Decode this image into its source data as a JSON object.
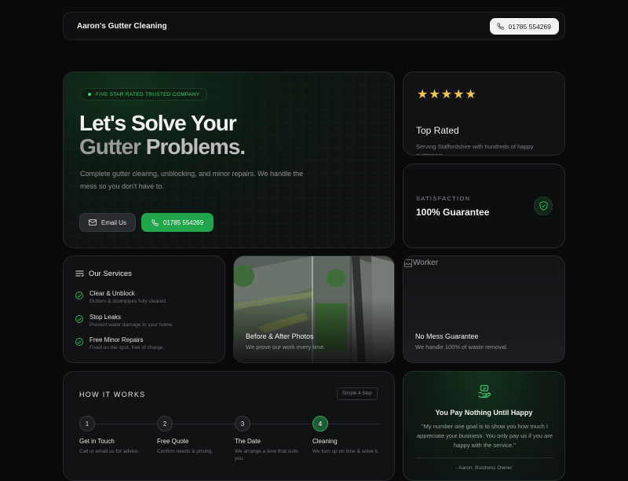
{
  "nav": {
    "brand": "Aaron's Gutter Cleaning",
    "phone": "01785 554269"
  },
  "hero": {
    "badge": "FIVE STAR RATED TRUSTED COMPANY",
    "title_line1": "Let's Solve Your",
    "title_line2_a": "Gutter",
    "title_line2_b": "Problems.",
    "subtitle": "Complete gutter clearing, unblocking, and minor repairs. We handle the mess so you don't have to.",
    "email_button": "Email Us",
    "call_button": "01785 554269"
  },
  "rated": {
    "stars": "★★★★★",
    "title": "Top Rated",
    "text": "Serving Staffordshire with hundreds of happy customers."
  },
  "guarantee": {
    "label": "SATISFACTION",
    "title": "100% Guarantee"
  },
  "services": {
    "title": "Our Services",
    "items": [
      {
        "title": "Clear & Unblock",
        "desc": "Gutters & downpipes fully cleared."
      },
      {
        "title": "Stop Leaks",
        "desc": "Prevent water damage to your home."
      },
      {
        "title": "Free Minor Repairs",
        "desc": "Fixed on the spot, free of charge."
      }
    ]
  },
  "photos": {
    "title": "Before & After Photos",
    "desc": "We prove our work every time."
  },
  "worker": {
    "alt": "Worker",
    "title": "No Mess Guarantee",
    "desc": "We handle 100% of waste removal."
  },
  "how": {
    "title": "HOW IT WORKS",
    "pill": "Simple 4-Step",
    "steps": [
      {
        "n": "1",
        "title": "Get in Touch",
        "desc": "Call or email us for advice."
      },
      {
        "n": "2",
        "title": "Free Quote",
        "desc": "Confirm needs & pricing."
      },
      {
        "n": "3",
        "title": "The Date",
        "desc": "We arrange a time that suits you."
      },
      {
        "n": "4",
        "title": "Cleaning",
        "desc": "We turn up on time & solve it."
      }
    ]
  },
  "happy": {
    "title": "You Pay Nothing Until Happy",
    "quote": "\"My number one goal is to show you how much I appreciate your business. You only pay us if you are happy with the service.\"",
    "author": "- Aaron, Business Owner"
  },
  "colors": {
    "accent": "#21a64b",
    "badge_text": "#3dd36b",
    "star": "#f3c64a",
    "background": "#0a0a0b"
  }
}
